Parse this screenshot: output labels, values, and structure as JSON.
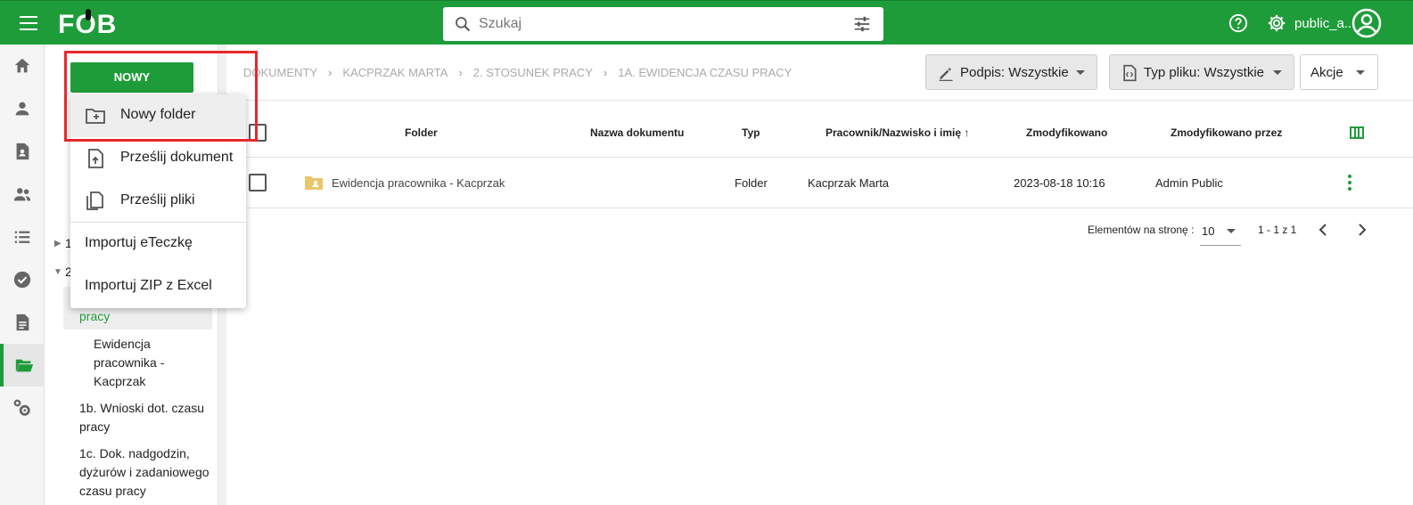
{
  "app": {
    "logo": "FOB",
    "username": "public_a..."
  },
  "search": {
    "placeholder": "Szukaj"
  },
  "new_menu": {
    "button_label": "NOWY",
    "items": [
      {
        "label": "Nowy folder",
        "icon": "folder-plus-icon"
      },
      {
        "label": "Prześlij dokument",
        "icon": "file-upload-icon"
      },
      {
        "label": "Prześlij pliki",
        "icon": "copy-files-icon"
      },
      {
        "label": "Importuj eTeczkę"
      },
      {
        "label": "Importuj ZIP z Excel"
      }
    ]
  },
  "tree": {
    "row1_num": "1",
    "row2_num": "2",
    "selected_tail": "pracy",
    "items": [
      {
        "label_lines": [
          "Ewidencja",
          "pracownika -",
          "Kacprzak"
        ]
      },
      {
        "label_lines": [
          "1b. Wnioski dot. czasu",
          "pracy"
        ]
      },
      {
        "label_lines": [
          "1c. Dok. nadgodzin,",
          "dyżurów i zadaniowego",
          "czasu pracy"
        ]
      }
    ]
  },
  "breadcrumb": [
    "DOKUMENTY",
    "KACPRZAK MARTA",
    "2. STOSUNEK PRACY",
    "1A. EWIDENCJA CZASU PRACY"
  ],
  "filters": {
    "signature": "Podpis: Wszystkie",
    "file_type": "Typ pliku: Wszystkie",
    "actions": "Akcje"
  },
  "table": {
    "headers": {
      "folder": "Folder",
      "doc_name": "Nazwa dokumentu",
      "type": "Typ",
      "employee": "Pracownik/Nazwisko i imię",
      "modified": "Zmodyfikowano",
      "modified_by": "Zmodyfikowano przez"
    },
    "rows": [
      {
        "folder": "Ewidencja pracownika - Kacprzak",
        "doc_name": "",
        "type": "Folder",
        "employee": "Kacprzak Marta",
        "modified": "2023-08-18 10:16",
        "modified_by": "Admin Public"
      }
    ]
  },
  "pagination": {
    "per_page_label": "Elementów na stronę :",
    "per_page_value": "10",
    "range": "1 - 1 z 1"
  },
  "colors": {
    "brand": "#1f9c3a",
    "highlight_frame": "#e8282b"
  }
}
